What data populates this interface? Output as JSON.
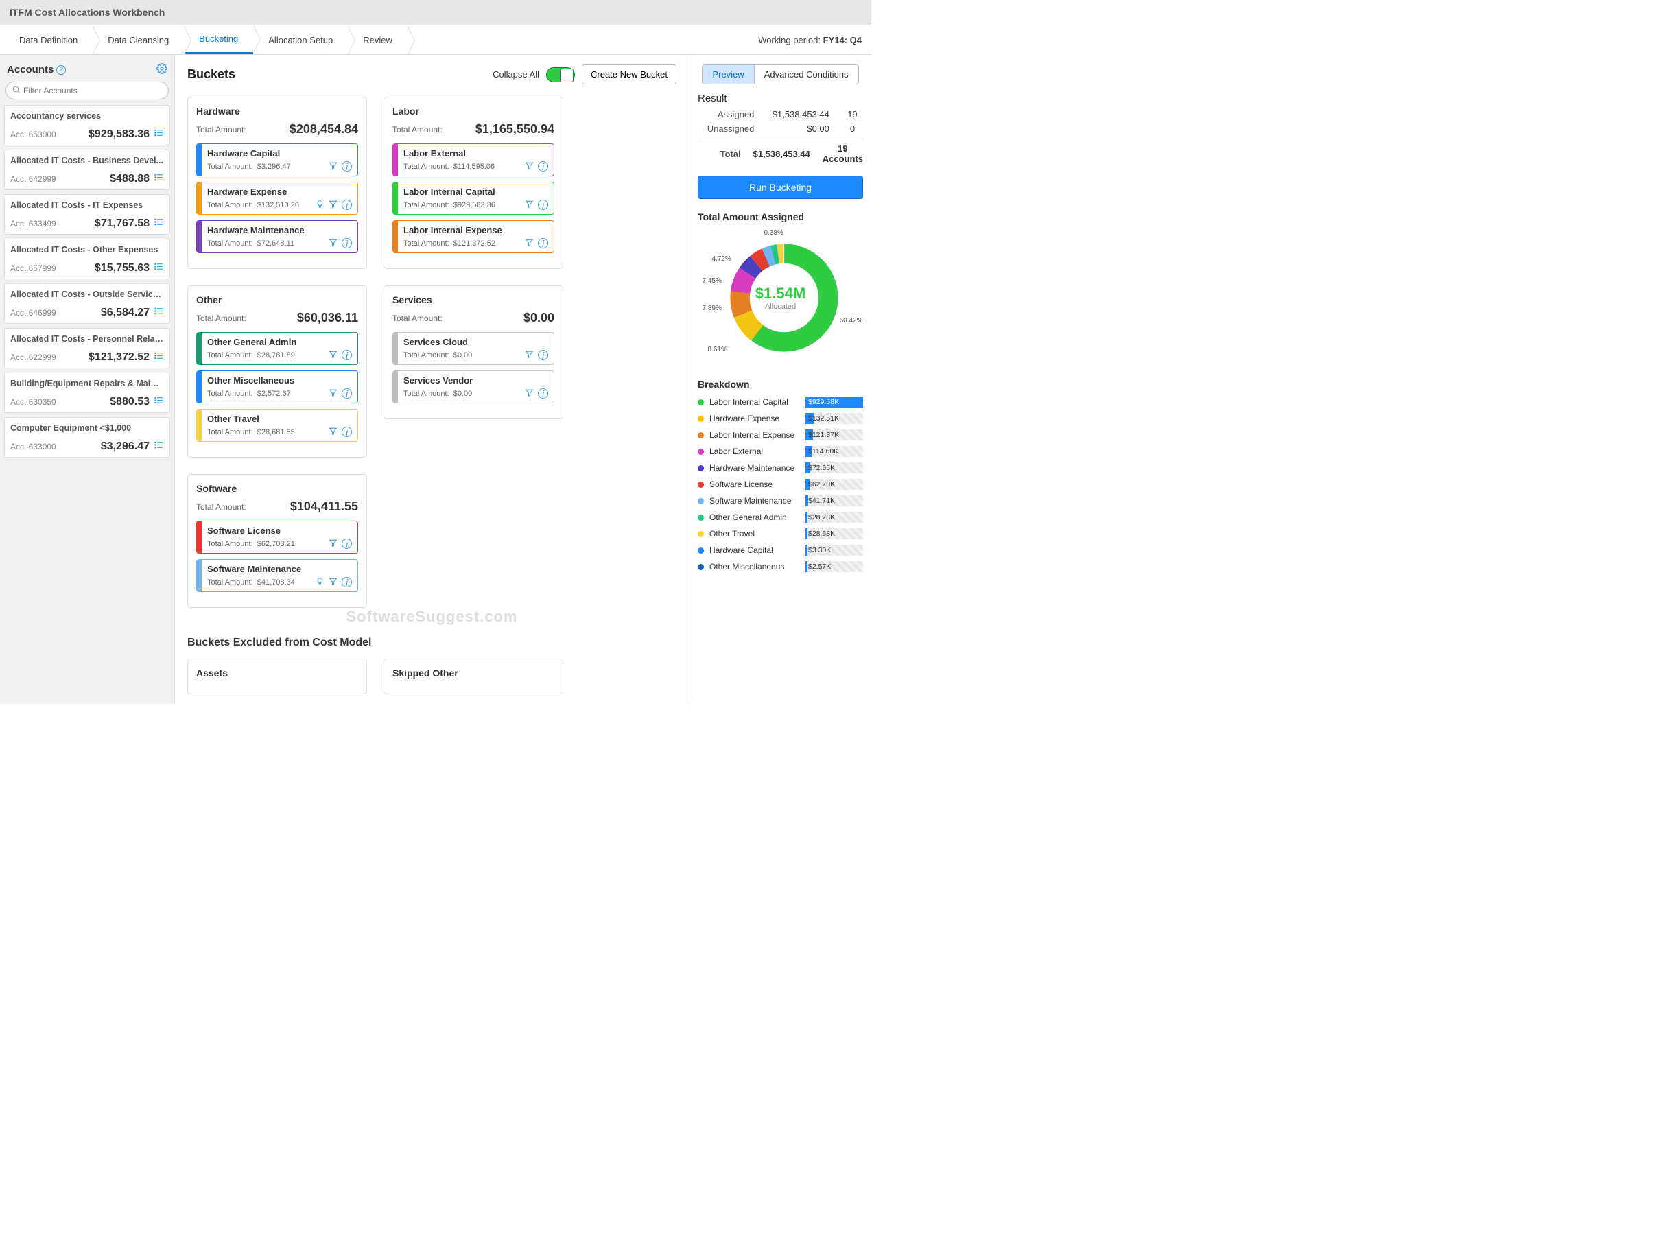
{
  "app_title": "ITFM Cost Allocations Workbench",
  "breadcrumb": [
    "Data Definition",
    "Data Cleansing",
    "Bucketing",
    "Allocation Setup",
    "Review"
  ],
  "breadcrumb_active": 2,
  "working_period_label": "Working period:",
  "working_period_value": "FY14: Q4",
  "accounts_title": "Accounts",
  "filter_placeholder": "Filter Accounts",
  "accounts": [
    {
      "name": "Accountancy services",
      "code": "Acc. 653000",
      "amount": "$929,583.36"
    },
    {
      "name": "Allocated IT Costs - Business Devel...",
      "code": "Acc. 642999",
      "amount": "$488.88"
    },
    {
      "name": "Allocated IT Costs - IT Expenses",
      "code": "Acc. 633499",
      "amount": "$71,767.58"
    },
    {
      "name": "Allocated IT Costs - Other Expenses",
      "code": "Acc. 657999",
      "amount": "$15,755.63"
    },
    {
      "name": "Allocated IT Costs - Outside Service...",
      "code": "Acc. 646999",
      "amount": "$6,584.27"
    },
    {
      "name": "Allocated IT Costs - Personnel Relat...",
      "code": "Acc. 622999",
      "amount": "$121,372.52"
    },
    {
      "name": "Building/Equipment Repairs & Maint...",
      "code": "Acc. 630350",
      "amount": "$880.53"
    },
    {
      "name": "Computer Equipment <$1,000",
      "code": "Acc. 633000",
      "amount": "$3,296.47"
    }
  ],
  "buckets_title": "Buckets",
  "collapse_all": "Collapse All",
  "create_bucket": "Create New Bucket",
  "total_amount_label": "Total Amount:",
  "excluded_title": "Buckets Excluded from Cost Model",
  "bucket_groups_left": [
    {
      "title": "Hardware",
      "amount": "$208,454.84",
      "subs": [
        {
          "title": "Hardware Capital",
          "amount": "$3,296.47",
          "color": "blue"
        },
        {
          "title": "Hardware Expense",
          "amount": "$132,510.26",
          "color": "orange",
          "extra": true
        },
        {
          "title": "Hardware Maintenance",
          "amount": "$72,648.11",
          "color": "purple"
        }
      ]
    },
    {
      "title": "Other",
      "amount": "$60,036.11",
      "subs": [
        {
          "title": "Other General Admin",
          "amount": "$28,781.89",
          "color": "teal"
        },
        {
          "title": "Other Miscellaneous",
          "amount": "$2,572.67",
          "color": "blue"
        },
        {
          "title": "Other Travel",
          "amount": "$28,681.55",
          "color": "yellow"
        }
      ]
    },
    {
      "title": "Software",
      "amount": "$104,411.55",
      "subs": [
        {
          "title": "Software License",
          "amount": "$62,703.21",
          "color": "red"
        },
        {
          "title": "Software Maintenance",
          "amount": "$41,708.34",
          "color": "lblue",
          "extra": true
        }
      ]
    }
  ],
  "bucket_groups_right": [
    {
      "title": "Labor",
      "amount": "$1,165,550.94",
      "subs": [
        {
          "title": "Labor External",
          "amount": "$114,595.06",
          "color": "magenta"
        },
        {
          "title": "Labor Internal Capital",
          "amount": "$929,583.36",
          "color": "green"
        },
        {
          "title": "Labor Internal Expense",
          "amount": "$121,372.52",
          "color": "orange2"
        }
      ]
    },
    {
      "title": "Services",
      "amount": "$0.00",
      "subs": [
        {
          "title": "Services Cloud",
          "amount": "$0.00",
          "color": "grey"
        },
        {
          "title": "Services Vendor",
          "amount": "$0.00",
          "color": "grey"
        }
      ]
    }
  ],
  "excluded_groups": [
    "Assets",
    "Skipped Other"
  ],
  "preview_tab": "Preview",
  "advanced_tab": "Advanced Conditions",
  "result_title": "Result",
  "result_rows": {
    "assigned_lbl": "Assigned",
    "assigned_v": "$1,538,453.44",
    "assigned_n": "19",
    "unassigned_lbl": "Unassigned",
    "unassigned_v": "$0.00",
    "unassigned_n": "0",
    "total_lbl": "Total",
    "total_v": "$1,538,453.44",
    "total_n": "19 Accounts"
  },
  "run_bucketing": "Run Bucketing",
  "total_assigned_title": "Total Amount Assigned",
  "donut_center_big": "$1.54M",
  "donut_center_small": "Allocated",
  "donut_labels": {
    "a": "60.42%",
    "b": "8.61%",
    "c": "7.89%",
    "d": "7.45%",
    "e": "4.72%",
    "f": "0.38%"
  },
  "breakdown_title": "Breakdown",
  "breakdown": [
    {
      "name": "Labor Internal Capital",
      "amount": "$929.58K",
      "pct": 100,
      "color": "#2ecc40",
      "white": true
    },
    {
      "name": "Hardware Expense",
      "amount": "$132.51K",
      "pct": 14,
      "color": "#f1c40f"
    },
    {
      "name": "Labor Internal Expense",
      "amount": "$121.37K",
      "pct": 13,
      "color": "#e67e22"
    },
    {
      "name": "Labor External",
      "amount": "$114.60K",
      "pct": 12,
      "color": "#d63bc0"
    },
    {
      "name": "Hardware Maintenance",
      "amount": "$72.65K",
      "pct": 8,
      "color": "#4a3fbf"
    },
    {
      "name": "Software License",
      "amount": "$62.70K",
      "pct": 7,
      "color": "#e43d30"
    },
    {
      "name": "Software Maintenance",
      "amount": "$41.71K",
      "pct": 5,
      "color": "#6fb5ef"
    },
    {
      "name": "Other General Admin",
      "amount": "$28.78K",
      "pct": 4,
      "color": "#27c48a"
    },
    {
      "name": "Other Travel",
      "amount": "$28.68K",
      "pct": 4,
      "color": "#f5d33b"
    },
    {
      "name": "Hardware Capital",
      "amount": "$3.30K",
      "pct": 3,
      "color": "#1e88ff"
    },
    {
      "name": "Other Miscellaneous",
      "amount": "$2.57K",
      "pct": 3,
      "color": "#1a5fb4"
    }
  ],
  "chart_data": {
    "type": "pie",
    "title": "Total Amount Assigned",
    "series": [
      {
        "name": "Allocated",
        "values": [
          {
            "label": "Labor Internal Capital",
            "pct": 60.42
          },
          {
            "label": "Hardware Expense",
            "pct": 8.61
          },
          {
            "label": "Labor Internal Expense",
            "pct": 7.89
          },
          {
            "label": "Labor External",
            "pct": 7.45
          },
          {
            "label": "Hardware Maintenance",
            "pct": 4.72
          },
          {
            "label": "Software License",
            "pct": 4.08
          },
          {
            "label": "Software Maintenance",
            "pct": 2.71
          },
          {
            "label": "Other General Admin",
            "pct": 1.87
          },
          {
            "label": "Other Travel",
            "pct": 1.86
          },
          {
            "label": "Hardware Capital",
            "pct": 0.21
          },
          {
            "label": "Other Miscellaneous",
            "pct": 0.17
          }
        ]
      }
    ],
    "center_value": "$1.54M",
    "center_label": "Allocated"
  },
  "watermark": "SoftwareSuggest.com"
}
